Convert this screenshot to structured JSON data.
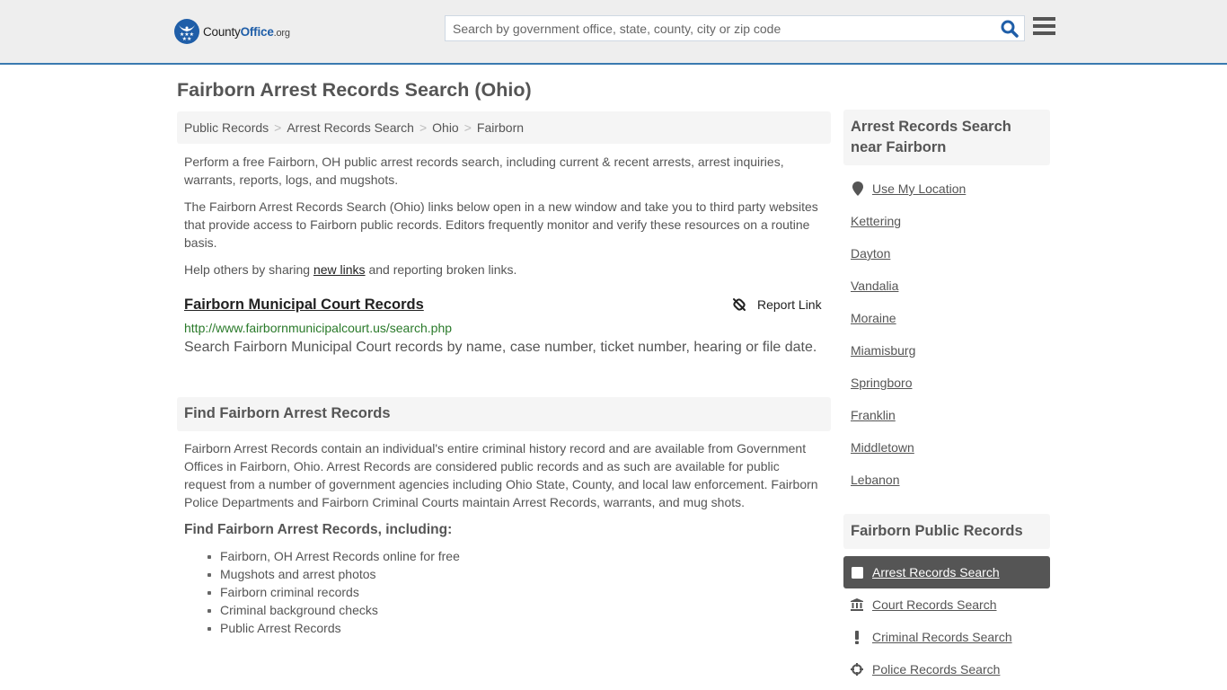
{
  "header": {
    "logo": {
      "part1": "County",
      "part2": "Office",
      "part3": ".org"
    },
    "search_placeholder": "Search by government office, state, county, city or zip code",
    "search_value": "",
    "search_icon": "search-icon",
    "menu_icon": "hamburger-menu-icon",
    "accent_color": "#3a7ab0"
  },
  "page_title": "Fairborn Arrest Records Search (Ohio)",
  "breadcrumb": [
    {
      "label": "Public Records"
    },
    {
      "label": "Arrest Records Search"
    },
    {
      "label": "Ohio"
    },
    {
      "label": "Fairborn"
    }
  ],
  "breadcrumb_separator": ">",
  "intro": {
    "p1": "Perform a free Fairborn, OH public arrest records search, including current & recent arrests, arrest inquiries, warrants, reports, logs, and mugshots.",
    "p2": "The Fairborn Arrest Records Search (Ohio) links below open in a new window and take you to third party websites that provide access to Fairborn public records. Editors frequently monitor and verify these resources on a routine basis.",
    "p3_before": "Help others by sharing ",
    "p3_link": "new links",
    "p3_after": " and reporting broken links."
  },
  "resource": {
    "title": "Fairborn Municipal Court Records",
    "report_label": "Report Link",
    "url": "http://www.fairbornmunicipalcourt.us/search.php",
    "description": "Search Fairborn Municipal Court records by name, case number, ticket number, hearing or file date."
  },
  "find_section": {
    "heading": "Find Fairborn Arrest Records",
    "body": "Fairborn Arrest Records contain an individual's entire criminal history record and are available from Government Offices in Fairborn, Ohio. Arrest Records are considered public records and as such are available for public request from a number of government agencies including Ohio State, County, and local law enforcement. Fairborn Police Departments and Fairborn Criminal Courts maintain Arrest Records, warrants, and mug shots.",
    "subheading": "Find Fairborn Arrest Records, including:",
    "items": [
      "Fairborn, OH Arrest Records online for free",
      "Mugshots and arrest photos",
      "Fairborn criminal records",
      "Criminal background checks",
      "Public Arrest Records"
    ]
  },
  "sidebar": {
    "nearby_heading": "Arrest Records Search near Fairborn",
    "use_location": "Use My Location",
    "nearby": [
      "Kettering",
      "Dayton",
      "Vandalia",
      "Moraine",
      "Miamisburg",
      "Springboro",
      "Franklin",
      "Middletown",
      "Lebanon"
    ],
    "public_heading": "Fairborn Public Records",
    "public_records": [
      {
        "label": "Arrest Records Search",
        "icon": "square-icon",
        "active": true
      },
      {
        "label": "Court Records Search",
        "icon": "courthouse-icon",
        "active": false
      },
      {
        "label": "Criminal Records Search",
        "icon": "exclamation-icon",
        "active": false
      },
      {
        "label": "Police Records Search",
        "icon": "crosshair-icon",
        "active": false
      }
    ]
  }
}
